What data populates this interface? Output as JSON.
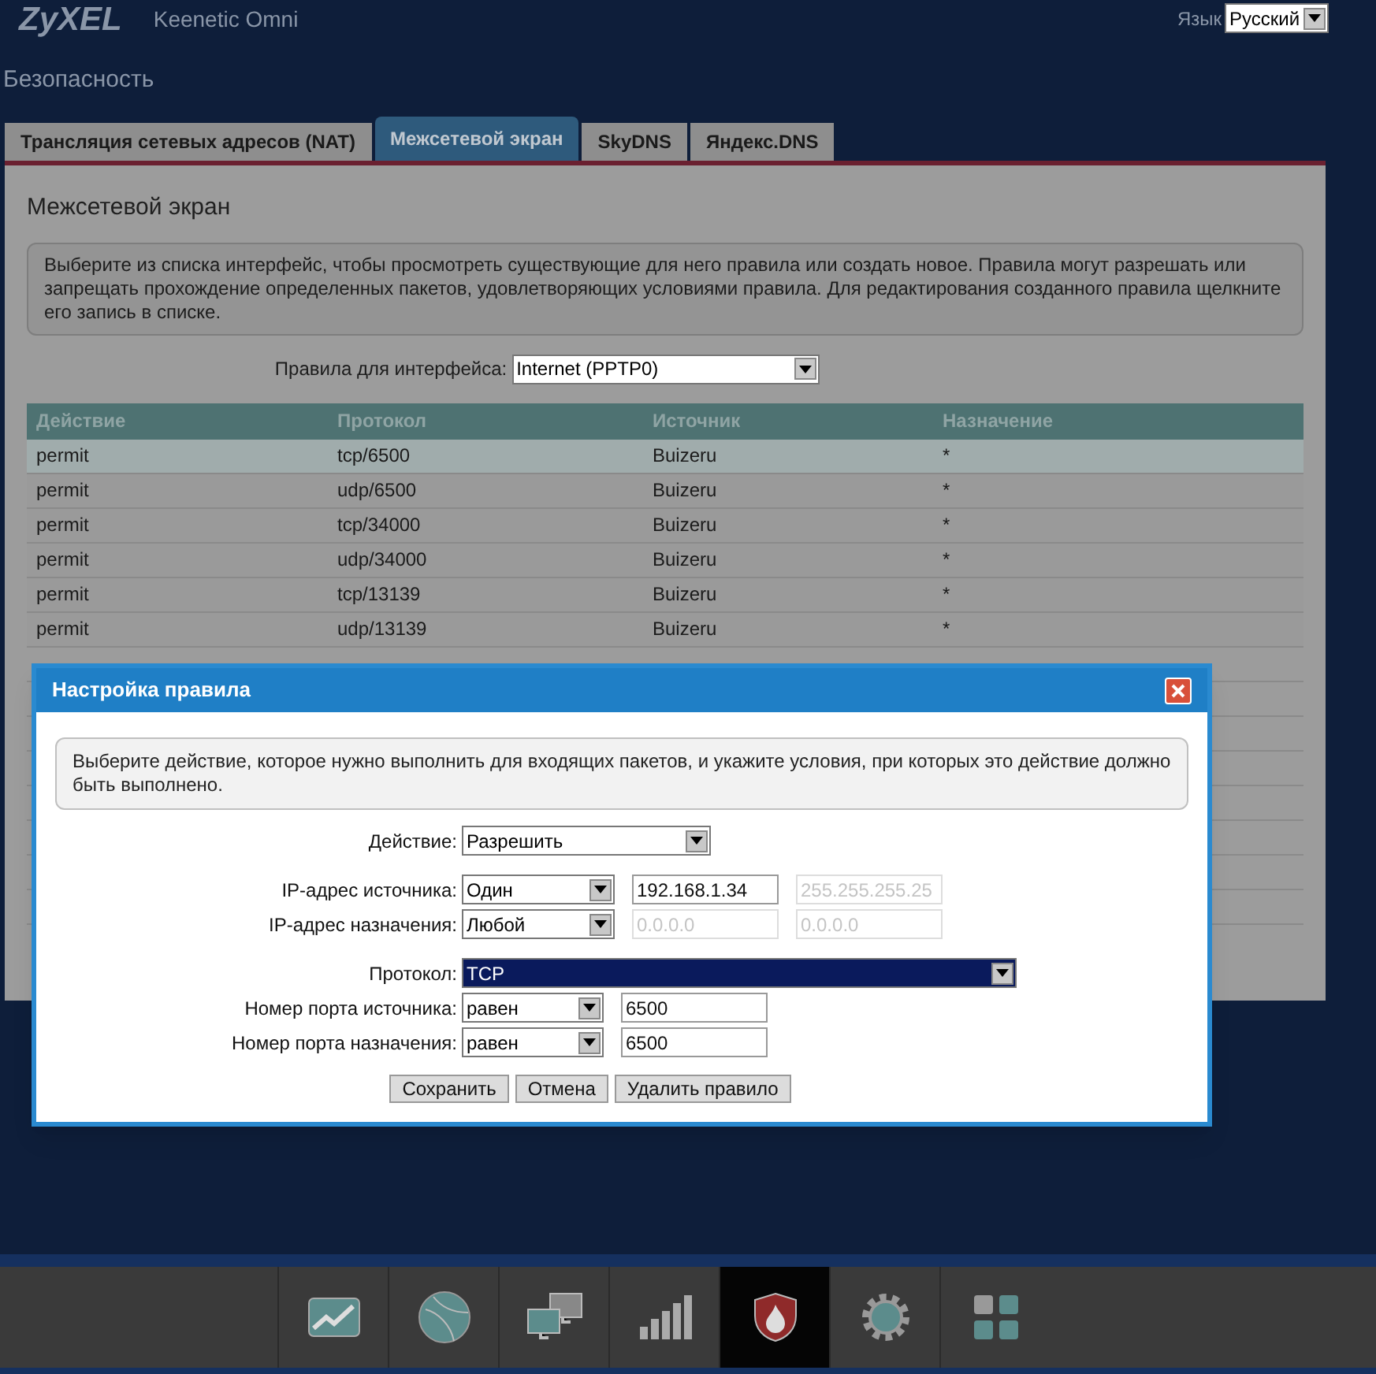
{
  "header": {
    "logo": "ZyXEL",
    "model": "Keenetic Omni",
    "language_label": "Язык",
    "language": "Русский"
  },
  "page_title": "Безопасность",
  "tabs": [
    {
      "label": "Трансляция сетевых адресов (NAT)",
      "selected": false
    },
    {
      "label": "Межсетевой экран",
      "selected": true
    },
    {
      "label": "SkyDNS",
      "selected": false
    },
    {
      "label": "Яндекс.DNS",
      "selected": false
    }
  ],
  "panel": {
    "title": "Межсетевой экран",
    "description": "Выберите из списка интерфейс, чтобы просмотреть существующие для него правила или создать новое. Правила могут разрешать или запрещать прохождение определенных пакетов, удовлетворяющих условиями правила. Для редактирования созданного правила щелкните его запись в списке.",
    "interface_label": "Правила для интерфейса:",
    "interface": "Internet (PPTP0)"
  },
  "table": {
    "columns": [
      "Действие",
      "Протокол",
      "Источник",
      "Назначение"
    ],
    "rows": [
      {
        "cells": [
          "permit",
          "tcp/6500",
          "Buizeru",
          "*"
        ],
        "selected": true
      },
      {
        "cells": [
          "permit",
          "udp/6500",
          "Buizeru",
          "*"
        ],
        "selected": false
      },
      {
        "cells": [
          "permit",
          "tcp/34000",
          "Buizeru",
          "*"
        ],
        "selected": false
      },
      {
        "cells": [
          "permit",
          "udp/34000",
          "Buizeru",
          "*"
        ],
        "selected": false
      },
      {
        "cells": [
          "permit",
          "tcp/13139",
          "Buizeru",
          "*"
        ],
        "selected": false
      },
      {
        "cells": [
          "permit",
          "udp/13139",
          "Buizeru",
          "*"
        ],
        "selected": false
      }
    ]
  },
  "dialog": {
    "title": "Настройка правила",
    "description": "Выберите действие, которое нужно выполнить для входящих пакетов, и укажите условия, при которых это действие должно быть выполнено.",
    "groups": [
      [
        {
          "kind": "action",
          "label": "Действие:",
          "select": "Разрешить",
          "highlighted": false
        }
      ],
      [
        {
          "kind": "address",
          "label": "IP-адрес источника:",
          "select": "Один",
          "highlighted": false,
          "inputs": [
            {
              "value": "192.168.1.34",
              "disabled": false
            },
            {
              "value": "255.255.255.25",
              "disabled": true
            }
          ]
        },
        {
          "kind": "address",
          "label": "IP-адрес назначения:",
          "select": "Любой",
          "highlighted": false,
          "inputs": [
            {
              "value": "0.0.0.0",
              "disabled": true
            },
            {
              "value": "0.0.0.0",
              "disabled": true
            }
          ]
        }
      ],
      [
        {
          "kind": "protocol",
          "label": "Протокол:",
          "select": "TCP",
          "highlighted": true
        },
        {
          "kind": "port",
          "label": "Номер порта источника:",
          "select": "равен",
          "highlighted": false,
          "inputs": [
            {
              "value": "6500",
              "disabled": false
            }
          ]
        },
        {
          "kind": "port",
          "label": "Номер порта назначения:",
          "select": "равен",
          "highlighted": false,
          "inputs": [
            {
              "value": "6500",
              "disabled": false
            }
          ]
        }
      ]
    ],
    "buttons": [
      "Сохранить",
      "Отмена",
      "Удалить правило"
    ]
  },
  "bottom_nav": [
    {
      "kind": "chart",
      "selected": false
    },
    {
      "kind": "globe",
      "selected": false
    },
    {
      "kind": "network",
      "selected": false
    },
    {
      "kind": "signal",
      "selected": false
    },
    {
      "kind": "shield",
      "selected": true
    },
    {
      "kind": "gear",
      "selected": false
    },
    {
      "kind": "grid",
      "selected": false
    }
  ]
}
